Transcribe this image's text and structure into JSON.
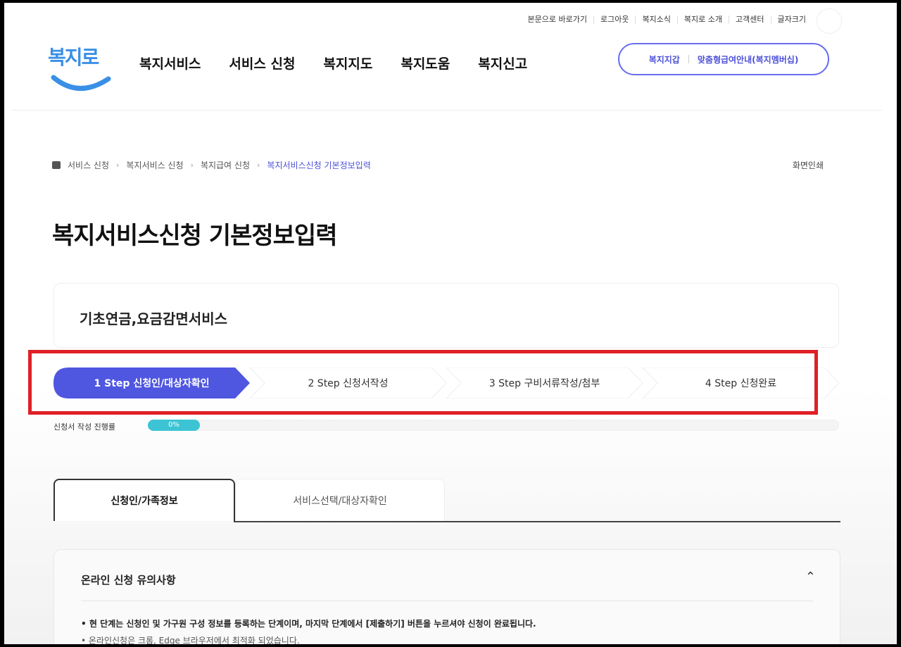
{
  "utility_links": [
    "본문으로 바로가기",
    "로그아웃",
    "복지소식",
    "복지로 소개",
    "고객센터",
    "글자크기"
  ],
  "logo": {
    "text": "복지로",
    "color": "#3a8fe6"
  },
  "gnb": [
    "복지서비스",
    "서비스 신청",
    "복지지도",
    "복지도움",
    "복지신고"
  ],
  "quick": {
    "left": "복지지갑",
    "right": "맞춤형급여안내(복지멤버십)"
  },
  "breadcrumb": [
    "서비스 신청",
    "복지서비스 신청",
    "복지급여 신청",
    "복지서비스신청 기본정보입력"
  ],
  "print_label": "화면인쇄",
  "page_title": "복지서비스신청 기본정보입력",
  "service_name": "기초연금,요금감면서비스",
  "steps": [
    {
      "label": "1 Step 신청인/대상자확인",
      "active": true
    },
    {
      "label": "2 Step 신청서작성",
      "active": false
    },
    {
      "label": "3 Step 구비서류작성/첨부",
      "active": false
    },
    {
      "label": "4 Step 신청완료",
      "active": false
    }
  ],
  "progress": {
    "label": "신청서 작성 진행률",
    "value_text": "0%",
    "value": 0
  },
  "tabs": [
    "신청인/가족정보",
    "서비스선택/대상자확인"
  ],
  "notice": {
    "heading": "온라인 신청 유의사항",
    "item1": "• 현 단계는 신청인 및 가구원 구성 정보를 등록하는 단계이며, 마지막 단계에서 [제출하기] 버튼을 누르셔야 신청이 완료됩니다.",
    "item2": "• 온라인신청은 크롬, Edge 브라우저에서 최적화 되었습니다."
  },
  "colors": {
    "accent": "#4b4fd8",
    "step_active": "#4f56e0",
    "progress": "#3cc4d4",
    "highlight_box": "#e01f26"
  }
}
